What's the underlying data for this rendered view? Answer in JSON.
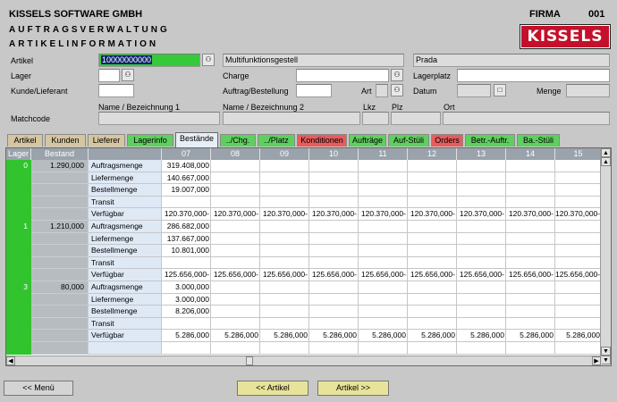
{
  "header": {
    "company": "KISSELS SOFTWARE GMBH",
    "firma_label": "FIRMA",
    "firma_value": "001",
    "line1": "AUFTRAGSVERWALTUNG",
    "line2": "ARTIKELINFORMATION",
    "logo_text": "KISSELS"
  },
  "form": {
    "artikel_label": "Artikel",
    "artikel_value": "10000000000",
    "artikel_desc": "Multifunktionsgestell",
    "artikel_brand": "Prada",
    "lager_label": "Lager",
    "charge_label": "Charge",
    "lagerplatz_label": "Lagerplatz",
    "kunde_label": "Kunde/Lieferant",
    "auftrag_label": "Auftrag/Bestellung",
    "art_label": "Art",
    "datum_label": "Datum",
    "menge_label": "Menge",
    "name1_label": "Name / Bezeichnung 1",
    "name2_label": "Name / Bezeichnung 2",
    "lkz_label": "Lkz",
    "plz_label": "Plz",
    "ort_label": "Ort",
    "matchcode_label": "Matchcode"
  },
  "tabs": [
    {
      "label": "Artikel",
      "color": "#d6c6a0"
    },
    {
      "label": "Kunden",
      "color": "#d6c6a0"
    },
    {
      "label": "Lieferer",
      "color": "#d6c6a0"
    },
    {
      "label": "Lagerinfo",
      "color": "#5fcf5f"
    },
    {
      "label": "Bestände",
      "color": "#e8eef6"
    },
    {
      "label": "../Chg.",
      "color": "#5fcf5f"
    },
    {
      "label": "../Platz",
      "color": "#5fcf5f"
    },
    {
      "label": "Konditionen",
      "color": "#e85c5c"
    },
    {
      "label": "Aufträge",
      "color": "#5fcf5f"
    },
    {
      "label": "Auf-Stüli",
      "color": "#5fcf5f"
    },
    {
      "label": "Orders",
      "color": "#e85c5c"
    },
    {
      "label": "Betr.-Auftr.",
      "color": "#5fcf5f"
    },
    {
      "label": "Ba.-Stüli",
      "color": "#5fcf5f"
    }
  ],
  "grid": {
    "headers": [
      "Lager",
      "Bestand",
      "",
      "07",
      "08",
      "09",
      "10",
      "11",
      "12",
      "13",
      "14",
      "15"
    ],
    "groups": [
      {
        "lager": "0",
        "bestand": "1.290,000",
        "rows": [
          {
            "label": "Auftragsmenge",
            "values": [
              "319.408,000",
              "",
              "",
              "",
              "",
              "",
              "",
              "",
              ""
            ]
          },
          {
            "label": "Liefermenge",
            "values": [
              "140.667,000",
              "",
              "",
              "",
              "",
              "",
              "",
              "",
              ""
            ]
          },
          {
            "label": "Bestellmenge",
            "values": [
              "19.007,000",
              "",
              "",
              "",
              "",
              "",
              "",
              "",
              ""
            ]
          },
          {
            "label": "Transit",
            "values": [
              "",
              "",
              "",
              "",
              "",
              "",
              "",
              "",
              ""
            ]
          },
          {
            "label": "Verfügbar",
            "values": [
              "120.370,000-",
              "120.370,000-",
              "120.370,000-",
              "120.370,000-",
              "120.370,000-",
              "120.370,000-",
              "120.370,000-",
              "120.370,000-",
              "120.370,000-"
            ]
          }
        ]
      },
      {
        "lager": "1",
        "bestand": "1.210,000",
        "rows": [
          {
            "label": "Auftragsmenge",
            "values": [
              "286.682,000",
              "",
              "",
              "",
              "",
              "",
              "",
              "",
              ""
            ]
          },
          {
            "label": "Liefermenge",
            "values": [
              "137.667,000",
              "",
              "",
              "",
              "",
              "",
              "",
              "",
              ""
            ]
          },
          {
            "label": "Bestellmenge",
            "values": [
              "10.801,000",
              "",
              "",
              "",
              "",
              "",
              "",
              "",
              ""
            ]
          },
          {
            "label": "Transit",
            "values": [
              "",
              "",
              "",
              "",
              "",
              "",
              "",
              "",
              ""
            ]
          },
          {
            "label": "Verfügbar",
            "values": [
              "125.656,000-",
              "125.656,000-",
              "125.656,000-",
              "125.656,000-",
              "125.656,000-",
              "125.656,000-",
              "125.656,000-",
              "125.656,000-",
              "125.656,000-"
            ]
          }
        ]
      },
      {
        "lager": "3",
        "bestand": "80,000",
        "rows": [
          {
            "label": "Auftragsmenge",
            "values": [
              "3.000,000",
              "",
              "",
              "",
              "",
              "",
              "",
              "",
              ""
            ]
          },
          {
            "label": "Liefermenge",
            "values": [
              "3.000,000",
              "",
              "",
              "",
              "",
              "",
              "",
              "",
              ""
            ]
          },
          {
            "label": "Bestellmenge",
            "values": [
              "8.206,000",
              "",
              "",
              "",
              "",
              "",
              "",
              "",
              ""
            ]
          },
          {
            "label": "Transit",
            "values": [
              "",
              "",
              "",
              "",
              "",
              "",
              "",
              "",
              ""
            ]
          },
          {
            "label": "Verfügbar",
            "values": [
              "5.286,000",
              "5.286,000",
              "5.286,000",
              "5.286,000",
              "5.286,000",
              "5.286,000",
              "5.286,000",
              "5.286,000",
              "5.286,000"
            ]
          }
        ]
      }
    ]
  },
  "footer": {
    "menu_btn": "<<  Menü",
    "artikel_prev_btn": "<<  Artikel",
    "artikel_next_btn": "Artikel >>"
  }
}
